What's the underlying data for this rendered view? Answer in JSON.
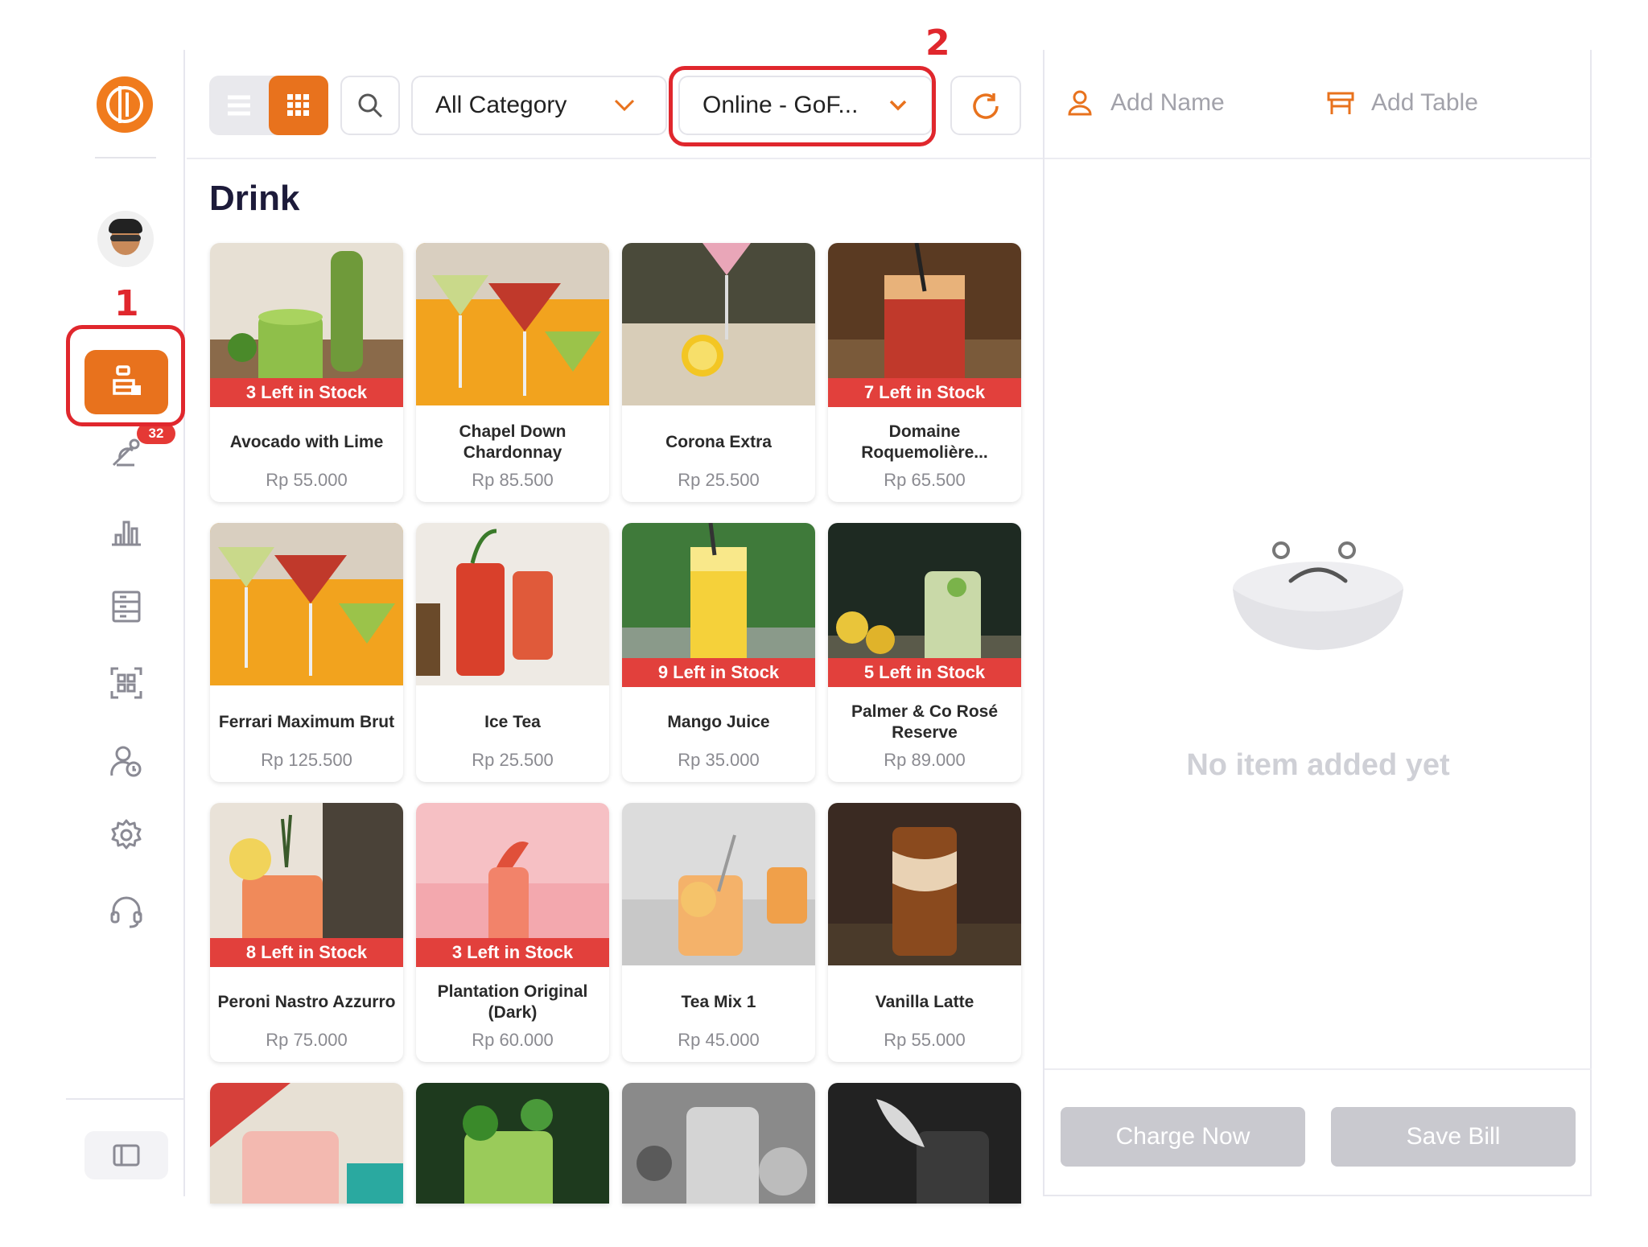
{
  "annotations": {
    "step1": "1",
    "step2": "2"
  },
  "sidebar": {
    "items": [
      {
        "icon": "pos-register-icon",
        "active": true
      },
      {
        "icon": "food-delivery-icon",
        "badge": "32"
      },
      {
        "icon": "bar-chart-icon"
      },
      {
        "icon": "inventory-icon"
      },
      {
        "icon": "qr-scan-icon"
      },
      {
        "icon": "customer-icon"
      },
      {
        "icon": "gear-icon"
      },
      {
        "icon": "headset-icon"
      }
    ]
  },
  "toolbar": {
    "category_select": "All Category",
    "order_type_select": "Online - GoF..."
  },
  "main": {
    "category_title": "Drink",
    "products": [
      {
        "name": "Avocado with Lime",
        "price": "Rp 55.000",
        "stock": "3 Left in Stock"
      },
      {
        "name": "Chapel Down Chardonnay",
        "price": "Rp 85.500",
        "stock": ""
      },
      {
        "name": "Corona Extra",
        "price": "Rp 25.500",
        "stock": ""
      },
      {
        "name": "Domaine Roquemolière...",
        "price": "Rp 65.500",
        "stock": "7 Left in Stock"
      },
      {
        "name": "Ferrari Maximum Brut",
        "price": "Rp 125.500",
        "stock": ""
      },
      {
        "name": "Ice Tea",
        "price": "Rp 25.500",
        "stock": ""
      },
      {
        "name": "Mango Juice",
        "price": "Rp 35.000",
        "stock": "9 Left in Stock"
      },
      {
        "name": "Palmer & Co Rosé Reserve",
        "price": "Rp 89.000",
        "stock": "5 Left in Stock"
      },
      {
        "name": "Peroni Nastro Azzurro",
        "price": "Rp 75.000",
        "stock": "8 Left in Stock"
      },
      {
        "name": "Plantation Original (Dark)",
        "price": "Rp 60.000",
        "stock": "3 Left in Stock"
      },
      {
        "name": "Tea Mix 1",
        "price": "Rp 45.000",
        "stock": ""
      },
      {
        "name": "Vanilla Latte",
        "price": "Rp 55.000",
        "stock": ""
      },
      {
        "name": "",
        "price": "",
        "stock": ""
      },
      {
        "name": "",
        "price": "",
        "stock": ""
      },
      {
        "name": "",
        "price": "",
        "stock": ""
      },
      {
        "name": "",
        "price": "",
        "stock": ""
      }
    ]
  },
  "order_panel": {
    "add_name": "Add Name",
    "add_table": "Add Table",
    "empty_message": "No item added yet",
    "charge_button": "Charge Now",
    "save_button": "Save Bill"
  },
  "colors": {
    "accent": "#e8721d",
    "annotation": "#e0272d",
    "stock_banner": "#e2403c",
    "disabled_button": "#c9c9cf"
  }
}
